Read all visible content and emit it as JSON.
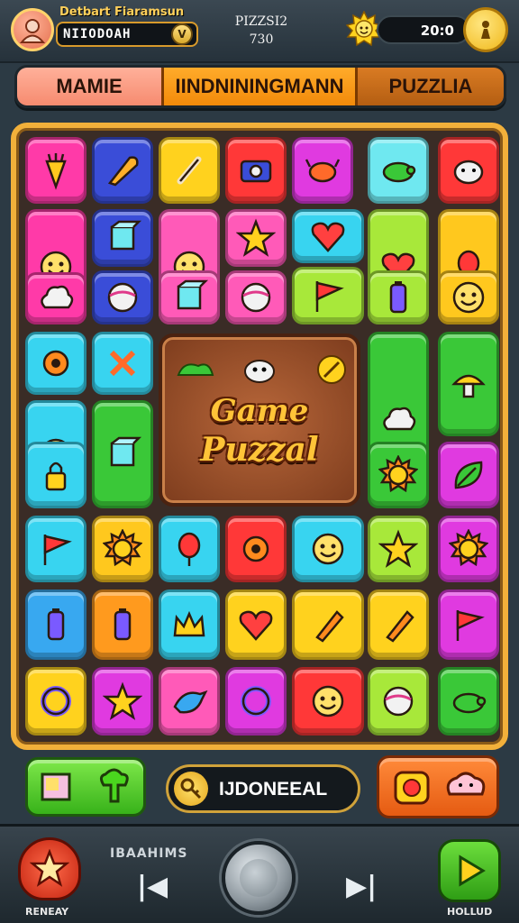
{
  "header": {
    "player_label": "Detbart Fiaramsun",
    "player_name": "NIIODOAH",
    "stats_line1": "PIZZSI2",
    "stats_line2": "730",
    "score": "20:0",
    "avatar_icon": "avatar-face-icon",
    "sun_icon": "sun-icon",
    "coin_icon": "coin-icon"
  },
  "tabs": [
    "MAMIE",
    "IINDNININGMANN",
    "PUZZLIA"
  ],
  "board": {
    "title_line1": "Game",
    "title_line2": "Puzzal",
    "tiles": [
      {
        "color": "#ff3aa8",
        "icon": "carrot-icon"
      },
      {
        "color": "#3a4dd8",
        "icon": "rocket-icon"
      },
      {
        "color": "#ffd21e",
        "icon": "bone-icon"
      },
      {
        "color": "#ff3838",
        "icon": "camera-icon"
      },
      {
        "color": "#e03ae0",
        "icon": "crab-icon"
      },
      {
        "color": "#6fe8f0",
        "icon": "turtle-icon"
      },
      {
        "color": "#ff3838",
        "icon": "cow-icon"
      },
      {
        "color": "#ff3aa8",
        "icon": "smile-face-icon"
      },
      {
        "color": "#3a4dd8",
        "icon": "cube-icon"
      },
      {
        "color": "#ff5ab8",
        "icon": "face-icon"
      },
      {
        "color": "#ff5ab8",
        "icon": "star-icon"
      },
      {
        "color": "#38d4f0",
        "icon": "heart-icon"
      },
      {
        "color": "#a8e83a",
        "icon": "heart-icon"
      },
      {
        "color": "#ffc81e",
        "icon": "balloon-icon"
      },
      {
        "color": "#ff3aa8",
        "icon": "cloud-icon"
      },
      {
        "color": "#3a4dd8",
        "icon": "egg-icon"
      },
      {
        "color": "#ff5ab8",
        "icon": "puzzle-piece-icon"
      },
      {
        "color": "#ff5ab8",
        "icon": "ball-icon"
      },
      {
        "color": "#a8e83a",
        "icon": "flag-icon"
      },
      {
        "color": "#a8e83a",
        "icon": "battery-icon"
      },
      {
        "color": "#ffc81e",
        "icon": "smile-face-icon"
      },
      {
        "color": "#38d4f0",
        "icon": "gear-icon"
      },
      {
        "color": "#38d4f0",
        "icon": "cross-icon"
      },
      {
        "color": "#38d4f0",
        "icon": "face-icon"
      },
      {
        "color": "#3ac838",
        "icon": "cloud-icon"
      },
      {
        "color": "#3ac838",
        "icon": "mushroom-icon"
      },
      {
        "color": "#e03ae0",
        "icon": "heart-icon"
      },
      {
        "color": "#38d4f0",
        "icon": "lock-icon"
      },
      {
        "color": "#3ac838",
        "icon": "book-icon"
      },
      {
        "color": "#3ac838",
        "icon": "sun-icon"
      },
      {
        "color": "#e03ae0",
        "icon": "leaf-icon"
      },
      {
        "color": "#38d4f0",
        "icon": "flag-icon"
      },
      {
        "color": "#ffc81e",
        "icon": "lion-icon"
      },
      {
        "color": "#38d4f0",
        "icon": "balloon-icon"
      },
      {
        "color": "#ff3838",
        "icon": "gear-icon"
      },
      {
        "color": "#38d4f0",
        "icon": "smile-face-icon"
      },
      {
        "color": "#a8e83a",
        "icon": "star-icon"
      },
      {
        "color": "#e03ae0",
        "icon": "sun-icon"
      },
      {
        "color": "#38a8f0",
        "icon": "battery-icon"
      },
      {
        "color": "#ff9a1e",
        "icon": "bottle-icon"
      },
      {
        "color": "#38d4f0",
        "icon": "crown-icon"
      },
      {
        "color": "#ffd21e",
        "icon": "heart-icon"
      },
      {
        "color": "#ffd21e",
        "icon": "brush-icon"
      },
      {
        "color": "#ffd21e",
        "icon": "pencil-icon"
      },
      {
        "color": "#e03ae0",
        "icon": "flag-icon"
      },
      {
        "color": "#ffd21e",
        "icon": "ring-icon"
      },
      {
        "color": "#e03ae0",
        "icon": "star-icon"
      },
      {
        "color": "#ff5ab8",
        "icon": "bird-icon"
      },
      {
        "color": "#e03ae0",
        "icon": "swirl-icon"
      },
      {
        "color": "#ff3838",
        "icon": "face-icon"
      },
      {
        "color": "#a8e83a",
        "icon": "ball-icon"
      },
      {
        "color": "#3ac838",
        "icon": "turtle-icon"
      },
      {
        "color": "#38d4f0",
        "icon": "fish-icon"
      },
      {
        "color": "#38d4f0",
        "icon": "lion-icon"
      }
    ]
  },
  "bottom": {
    "search_text": "IJDONEEAL",
    "key_icon": "key-icon"
  },
  "footer": {
    "left_label": "RENEAY",
    "right_label": "HOLLUD",
    "mid_label": "IBAAHIMS"
  },
  "colors": {
    "board_border": "#f2b03a",
    "background": "#2c3a44"
  }
}
